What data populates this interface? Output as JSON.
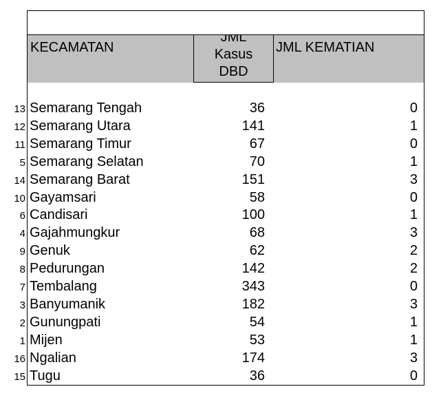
{
  "table": {
    "headers": {
      "kecamatan": "KECAMATAN",
      "kasus_line1": "JML",
      "kasus_line2": "Kasus",
      "kasus_line3": "DBD",
      "kematian": "JML KEMATIAN"
    },
    "rows": [
      {
        "no": "13",
        "nama": "Semarang Tengah",
        "kasus": "36",
        "kematian": "0"
      },
      {
        "no": "12",
        "nama": "Semarang Utara",
        "kasus": "141",
        "kematian": "1"
      },
      {
        "no": "11",
        "nama": "Semarang Timur",
        "kasus": "67",
        "kematian": "0"
      },
      {
        "no": "5",
        "nama": "Semarang Selatan",
        "kasus": "70",
        "kematian": "1"
      },
      {
        "no": "14",
        "nama": "Semarang Barat",
        "kasus": "151",
        "kematian": "3"
      },
      {
        "no": "10",
        "nama": "Gayamsari",
        "kasus": "58",
        "kematian": "0"
      },
      {
        "no": "6",
        "nama": "Candisari",
        "kasus": "100",
        "kematian": "1"
      },
      {
        "no": "4",
        "nama": "Gajahmungkur",
        "kasus": "68",
        "kematian": "3"
      },
      {
        "no": "9",
        "nama": "Genuk",
        "kasus": "62",
        "kematian": "2"
      },
      {
        "no": "8",
        "nama": "Pedurungan",
        "kasus": "142",
        "kematian": "2"
      },
      {
        "no": "7",
        "nama": "Tembalang",
        "kasus": "343",
        "kematian": "0"
      },
      {
        "no": "3",
        "nama": "Banyumanik",
        "kasus": "182",
        "kematian": "3"
      },
      {
        "no": "2",
        "nama": "Gunungpati",
        "kasus": "54",
        "kematian": "1"
      },
      {
        "no": "1",
        "nama": "Mijen",
        "kasus": "53",
        "kematian": "1"
      },
      {
        "no": "16",
        "nama": "Ngalian",
        "kasus": "174",
        "kematian": "3"
      },
      {
        "no": "15",
        "nama": "Tugu",
        "kasus": "36",
        "kematian": "0"
      }
    ]
  }
}
